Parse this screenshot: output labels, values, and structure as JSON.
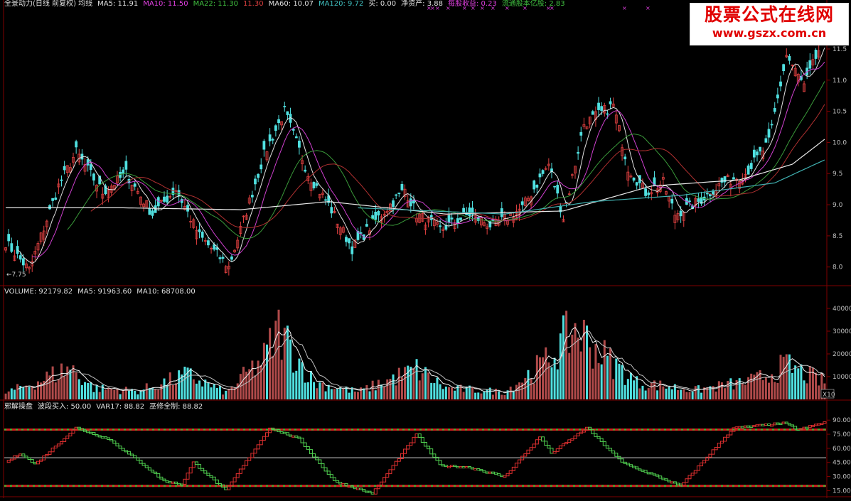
{
  "legend_main": [
    {
      "text": "全景动力(日线 前复权) 均线",
      "color": "#e0e0e0"
    },
    {
      "text": "MA5: 11.91",
      "color": "#e0e0e0"
    },
    {
      "text": "MA10: 11.50",
      "color": "#e040e0"
    },
    {
      "text": "MA22: 11.30",
      "color": "#40c040"
    },
    {
      "text": "11.30",
      "color": "#e04040"
    },
    {
      "text": "MA60: 10.07",
      "color": "#e0e0e0"
    },
    {
      "text": "MA120: 9.72",
      "color": "#40c0c0"
    },
    {
      "text": "买: 0.00",
      "color": "#e0e0e0"
    },
    {
      "text": "净资产: 3.88",
      "color": "#e0e0e0"
    },
    {
      "text": "每股收益: 0.23",
      "color": "#e040e0"
    },
    {
      "text": "流通股本亿股: 2.83",
      "color": "#40c040"
    }
  ],
  "legend_volume": [
    {
      "text": "VOLUME: 92179.82",
      "color": "#e0e0e0"
    },
    {
      "text": "MA5: 91963.60",
      "color": "#e0e0e0"
    },
    {
      "text": "MA10: 68708.00",
      "color": "#e0e0e0"
    }
  ],
  "legend_indicator": [
    {
      "text": "邪解操盘",
      "color": "#e0e0e0"
    },
    {
      "text": "波段买入: 50.00",
      "color": "#e0e0e0"
    },
    {
      "text": "VAR17: 88.82",
      "color": "#e0e0e0"
    },
    {
      "text": "巫修全制: 88.82",
      "color": "#e0e0e0"
    }
  ],
  "watermark": {
    "line1": "股票公式在线网",
    "line2": "www.gszx.com.cn"
  },
  "low_marker": "←7.75",
  "volume_unit_label": "X10",
  "colors": {
    "up": "#e04040",
    "down": "#50e0e0",
    "bull_step": "#e03030",
    "bear_step": "#50d050",
    "grid": "#800000",
    "axis_text": "#c0c0c0"
  },
  "chart_data": [
    {
      "type": "candlestick",
      "title": "全景动力(日线 前复权)",
      "ylim": [
        7.7,
        12.15
      ],
      "y_ticks": [
        "8.0",
        "8.5",
        "9.0",
        "9.5",
        "10.0",
        "10.5",
        "11.0",
        "11.5",
        "12.0"
      ],
      "min_label": "7.75",
      "series": [
        {
          "name": "MA5",
          "color": "#e0e0e0"
        },
        {
          "name": "MA10",
          "color": "#e040e0"
        },
        {
          "name": "MA22",
          "color": "#40c040"
        },
        {
          "name": "MA60",
          "color": "#e0e0e0"
        },
        {
          "name": "MA120",
          "color": "#40c0c0"
        }
      ],
      "close_path": [
        {
          "i": 0,
          "v": 8.4
        },
        {
          "i": 8,
          "v": 7.95
        },
        {
          "i": 18,
          "v": 9.3
        },
        {
          "i": 24,
          "v": 9.85
        },
        {
          "i": 33,
          "v": 9.2
        },
        {
          "i": 41,
          "v": 9.5
        },
        {
          "i": 50,
          "v": 8.85
        },
        {
          "i": 58,
          "v": 9.25
        },
        {
          "i": 66,
          "v": 8.5
        },
        {
          "i": 76,
          "v": 8.0
        },
        {
          "i": 88,
          "v": 9.8
        },
        {
          "i": 95,
          "v": 10.5
        },
        {
          "i": 103,
          "v": 9.5
        },
        {
          "i": 110,
          "v": 9.0
        },
        {
          "i": 118,
          "v": 8.3
        },
        {
          "i": 126,
          "v": 8.75
        },
        {
          "i": 136,
          "v": 9.25
        },
        {
          "i": 140,
          "v": 8.85
        },
        {
          "i": 148,
          "v": 8.6
        },
        {
          "i": 158,
          "v": 8.85
        },
        {
          "i": 166,
          "v": 8.65
        },
        {
          "i": 176,
          "v": 8.95
        },
        {
          "i": 185,
          "v": 9.65
        },
        {
          "i": 190,
          "v": 8.8
        },
        {
          "i": 197,
          "v": 10.3
        },
        {
          "i": 207,
          "v": 10.6
        },
        {
          "i": 212,
          "v": 9.6
        },
        {
          "i": 218,
          "v": 9.2
        },
        {
          "i": 224,
          "v": 9.35
        },
        {
          "i": 228,
          "v": 8.85
        },
        {
          "i": 236,
          "v": 9.05
        },
        {
          "i": 244,
          "v": 9.35
        },
        {
          "i": 252,
          "v": 9.5
        },
        {
          "i": 260,
          "v": 10.0
        },
        {
          "i": 266,
          "v": 11.4
        },
        {
          "i": 272,
          "v": 10.9
        },
        {
          "i": 279,
          "v": 11.7
        }
      ],
      "ma60_path": [
        {
          "i": 0,
          "v": 8.95
        },
        {
          "i": 40,
          "v": 8.95
        },
        {
          "i": 80,
          "v": 8.92
        },
        {
          "i": 110,
          "v": 9.05
        },
        {
          "i": 150,
          "v": 8.85
        },
        {
          "i": 190,
          "v": 8.9
        },
        {
          "i": 220,
          "v": 9.3
        },
        {
          "i": 250,
          "v": 9.4
        },
        {
          "i": 268,
          "v": 9.65
        },
        {
          "i": 279,
          "v": 10.05
        }
      ],
      "ma120_path": [
        {
          "i": 120,
          "v": 8.95
        },
        {
          "i": 170,
          "v": 8.85
        },
        {
          "i": 200,
          "v": 9.05
        },
        {
          "i": 230,
          "v": 9.15
        },
        {
          "i": 262,
          "v": 9.35
        },
        {
          "i": 279,
          "v": 9.72
        }
      ]
    },
    {
      "type": "bar",
      "title": "VOLUME",
      "ylim": [
        0,
        45000
      ],
      "y_ticks": [
        "10000",
        "20000",
        "30000",
        "40000"
      ],
      "peaks": [
        {
          "i": 0,
          "v": 3500
        },
        {
          "i": 10,
          "v": 9000
        },
        {
          "i": 22,
          "v": 17000
        },
        {
          "i": 30,
          "v": 6000
        },
        {
          "i": 45,
          "v": 4500
        },
        {
          "i": 62,
          "v": 13000
        },
        {
          "i": 75,
          "v": 3500
        },
        {
          "i": 88,
          "v": 22000
        },
        {
          "i": 93,
          "v": 37000
        },
        {
          "i": 105,
          "v": 9000
        },
        {
          "i": 120,
          "v": 4000
        },
        {
          "i": 140,
          "v": 16000
        },
        {
          "i": 150,
          "v": 6000
        },
        {
          "i": 170,
          "v": 4000
        },
        {
          "i": 184,
          "v": 20000
        },
        {
          "i": 194,
          "v": 38000
        },
        {
          "i": 203,
          "v": 24000
        },
        {
          "i": 215,
          "v": 9000
        },
        {
          "i": 235,
          "v": 5000
        },
        {
          "i": 255,
          "v": 10000
        },
        {
          "i": 266,
          "v": 18000
        },
        {
          "i": 279,
          "v": 9000
        }
      ]
    },
    {
      "type": "line",
      "title": "邪解操盘",
      "ylim": [
        10,
        100
      ],
      "y_ticks": [
        "15.00",
        "30.00",
        "45.00",
        "60.00",
        "75.00",
        "90.00"
      ],
      "reference_lines": [
        20,
        50,
        80
      ],
      "var17_path": [
        {
          "i": 0,
          "v": 45
        },
        {
          "i": 5,
          "v": 55
        },
        {
          "i": 10,
          "v": 43
        },
        {
          "i": 24,
          "v": 82
        },
        {
          "i": 35,
          "v": 70
        },
        {
          "i": 48,
          "v": 40
        },
        {
          "i": 54,
          "v": 25
        },
        {
          "i": 60,
          "v": 22
        },
        {
          "i": 64,
          "v": 45
        },
        {
          "i": 75,
          "v": 15
        },
        {
          "i": 90,
          "v": 82
        },
        {
          "i": 100,
          "v": 70
        },
        {
          "i": 112,
          "v": 25
        },
        {
          "i": 125,
          "v": 12
        },
        {
          "i": 140,
          "v": 75
        },
        {
          "i": 148,
          "v": 42
        },
        {
          "i": 158,
          "v": 40
        },
        {
          "i": 170,
          "v": 30
        },
        {
          "i": 182,
          "v": 72
        },
        {
          "i": 186,
          "v": 55
        },
        {
          "i": 198,
          "v": 82
        },
        {
          "i": 210,
          "v": 45
        },
        {
          "i": 230,
          "v": 20
        },
        {
          "i": 248,
          "v": 82
        },
        {
          "i": 265,
          "v": 87
        },
        {
          "i": 270,
          "v": 80
        },
        {
          "i": 279,
          "v": 88
        }
      ]
    }
  ]
}
